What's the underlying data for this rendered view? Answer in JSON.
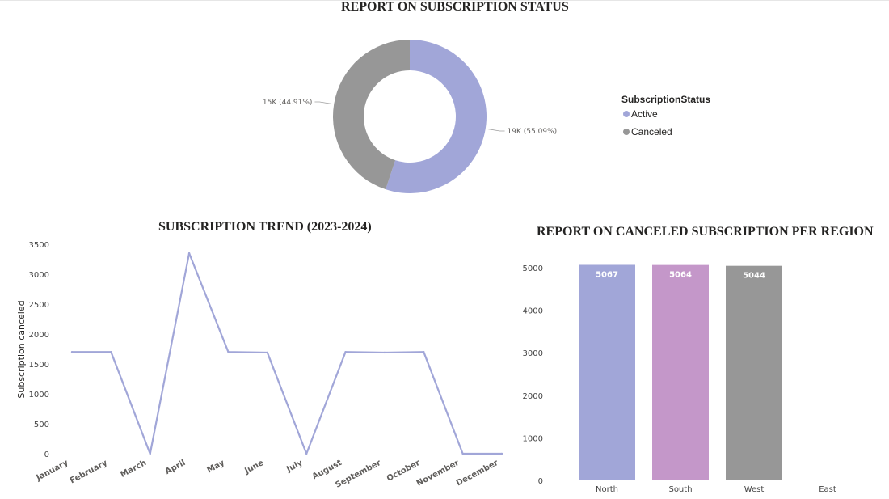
{
  "colors": {
    "active": "#a1a6d8",
    "canceled": "#979797",
    "north": "#a1a6d8",
    "south": "#c497c9",
    "west": "#979797",
    "line": "#a1a6d8"
  },
  "chart_data": [
    {
      "type": "pie",
      "title": "REPORT ON SUBSCRIPTION STATUS",
      "legend_title": "SubscriptionStatus",
      "legend_position": "right",
      "slices": [
        {
          "name": "Active",
          "value": 19000,
          "percent": 55.09,
          "label": "19K (55.09%)",
          "color": "#a1a6d8"
        },
        {
          "name": "Canceled",
          "value": 15000,
          "percent": 44.91,
          "label": "15K (44.91%)",
          "color": "#979797"
        }
      ]
    },
    {
      "type": "line",
      "title": "SUBSCRIPTION TREND (2023-2024)",
      "ylabel": "Subscription canceled",
      "ylim": [
        0,
        3500
      ],
      "yticks": [
        "0",
        "500",
        "1000",
        "1500",
        "2000",
        "2500",
        "3000",
        "3500"
      ],
      "categories": [
        "January",
        "February",
        "March",
        "April",
        "May",
        "June",
        "July",
        "August",
        "September",
        "October",
        "November",
        "December"
      ],
      "values": [
        1700,
        1700,
        0,
        3350,
        1700,
        1690,
        0,
        1700,
        1690,
        1700,
        0,
        0
      ]
    },
    {
      "type": "bar",
      "title": "REPORT ON CANCELED SUBSCRIPTION PER REGION",
      "ylim": [
        0,
        5000
      ],
      "yticks": [
        "0",
        "1000",
        "2000",
        "3000",
        "4000",
        "5000"
      ],
      "categories": [
        "North",
        "South",
        "West",
        "East"
      ],
      "values": [
        5067,
        5064,
        5044,
        null
      ],
      "data_labels": [
        "5067",
        "5064",
        "5044",
        ""
      ],
      "colors": [
        "#a1a6d8",
        "#c497c9",
        "#979797",
        "#979797"
      ]
    }
  ]
}
